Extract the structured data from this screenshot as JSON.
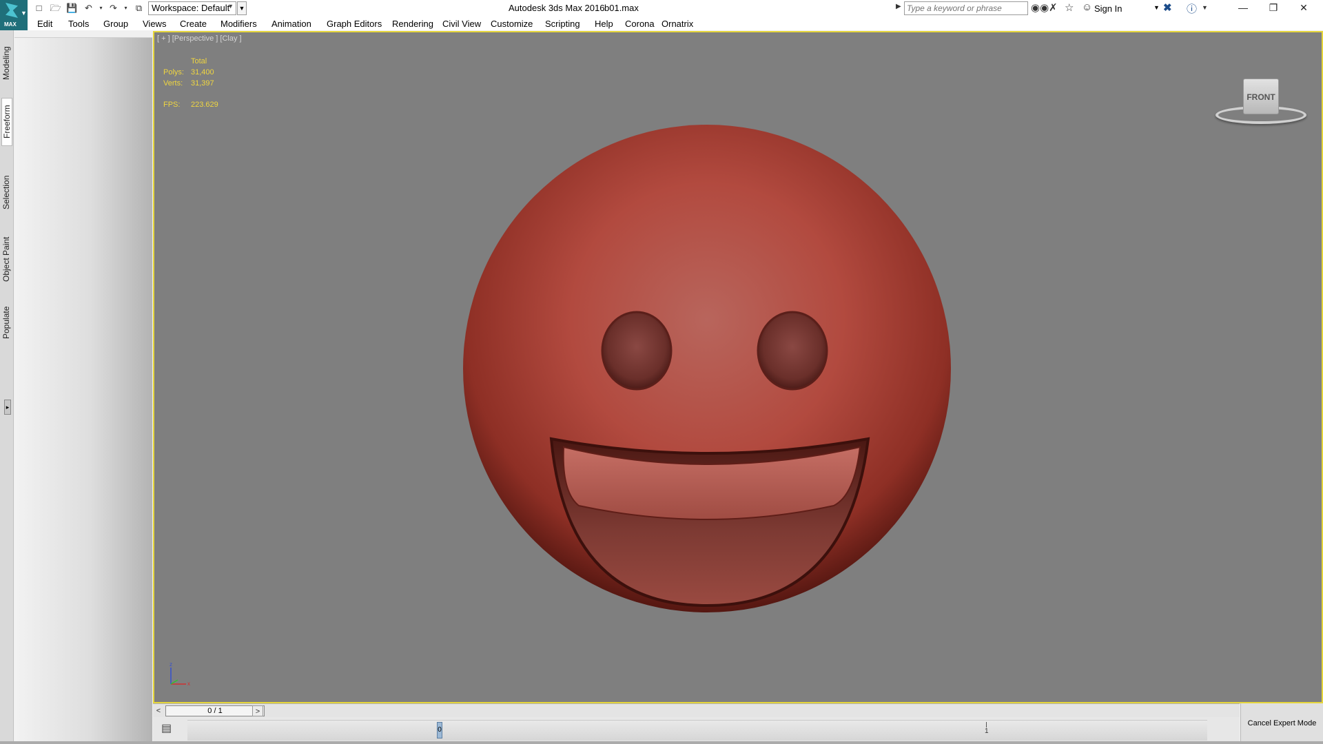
{
  "app": {
    "logo_tag": "MAX",
    "title": "Autodesk 3ds Max 2016",
    "file": "b01.max"
  },
  "quick_access": {
    "icons": [
      "new-icon",
      "open-icon",
      "save-icon",
      "undo-icon",
      "redo-icon",
      "project-folder-icon"
    ],
    "workspace_label": "Workspace: Default"
  },
  "header": {
    "search_placeholder": "Type a keyword or phrase",
    "sign_in": "Sign In",
    "icons": [
      "binoculars-icon",
      "communication-center-icon",
      "favorites-star-icon",
      "user-icon",
      "exchange-x-icon",
      "help-icon"
    ]
  },
  "menu": [
    "Edit",
    "Tools",
    "Group",
    "Views",
    "Create",
    "Modifiers",
    "Animation",
    "Graph Editors",
    "Rendering",
    "Civil View",
    "Customize",
    "Scripting",
    "Help",
    "Corona",
    "Ornatrix"
  ],
  "ribbon_tabs": [
    "Modeling",
    "Freeform",
    "Selection",
    "Object Paint",
    "Populate"
  ],
  "ribbon_active": "Freeform",
  "viewport": {
    "label": "[ + ] [Perspective ] [Clay ]",
    "stats_header": "Total",
    "polys_label": "Polys:",
    "polys_value": "31,400",
    "verts_label": "Verts:",
    "verts_value": "31,397",
    "fps_label": "FPS:",
    "fps_value": "223.629",
    "viewcube_face": "FRONT",
    "axis_z": "z",
    "axis_x": "x",
    "border_color": "#e6d63a",
    "background_color": "#7f7f7f",
    "model_color": "#b24a3f"
  },
  "timeline": {
    "prev": "<",
    "next": ">",
    "frame_display": "0 / 1",
    "current_frame_marker": "0",
    "end_frame": "1"
  },
  "status": {
    "cancel_expert_mode": "Cancel Expert Mode"
  }
}
